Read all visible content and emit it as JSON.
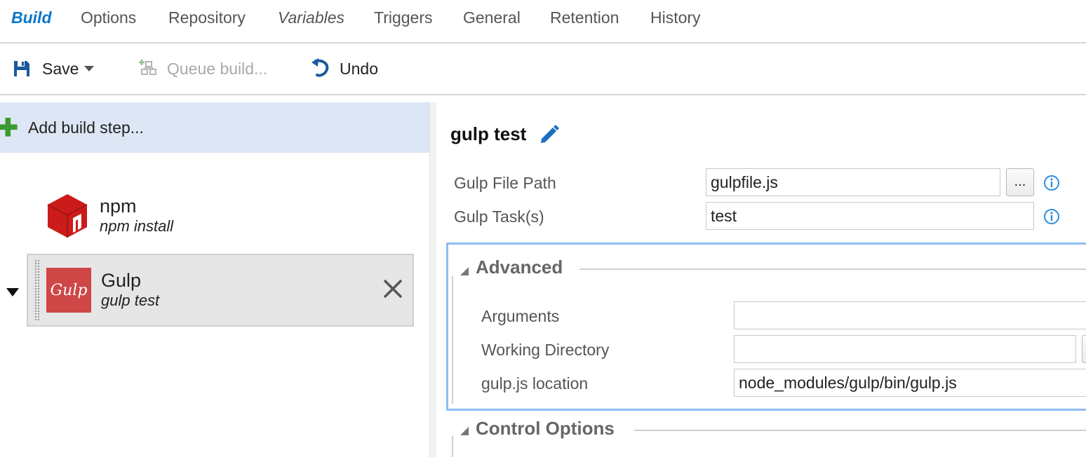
{
  "tabs": [
    {
      "label": "Build"
    },
    {
      "label": "Options"
    },
    {
      "label": "Repository"
    },
    {
      "label": "Variables"
    },
    {
      "label": "Triggers"
    },
    {
      "label": "General"
    },
    {
      "label": "Retention"
    },
    {
      "label": "History"
    }
  ],
  "toolbar": {
    "save_label": "Save",
    "queue_label": "Queue build...",
    "undo_label": "Undo"
  },
  "steps_panel": {
    "add_label": "Add build step...",
    "steps": [
      {
        "name": "npm",
        "subtitle": "npm install",
        "icon": "npm-icon"
      },
      {
        "name": "Gulp",
        "subtitle": "gulp test",
        "icon": "gulp-icon",
        "selected": true
      }
    ]
  },
  "task": {
    "title": "gulp test",
    "fields": [
      {
        "label": "Gulp File Path",
        "value": "gulpfile.js",
        "browse": "..."
      },
      {
        "label": "Gulp Task(s)",
        "value": "test"
      }
    ],
    "advanced": {
      "title": "Advanced",
      "fields": [
        {
          "label": "Arguments",
          "value": ""
        },
        {
          "label": "Working Directory",
          "value": ""
        },
        {
          "label": "gulp.js location",
          "value": "node_modules/gulp/bin/gulp.js"
        }
      ]
    },
    "control_options": {
      "title": "Control Options"
    }
  },
  "colors": {
    "accent": "#0a77c9",
    "selected_bg": "#dce6f4",
    "add_green": "#3a9a2f",
    "npm_red": "#cb1b1b",
    "gulp_red": "#cf4646",
    "focus_border": "#8dbdf0"
  }
}
